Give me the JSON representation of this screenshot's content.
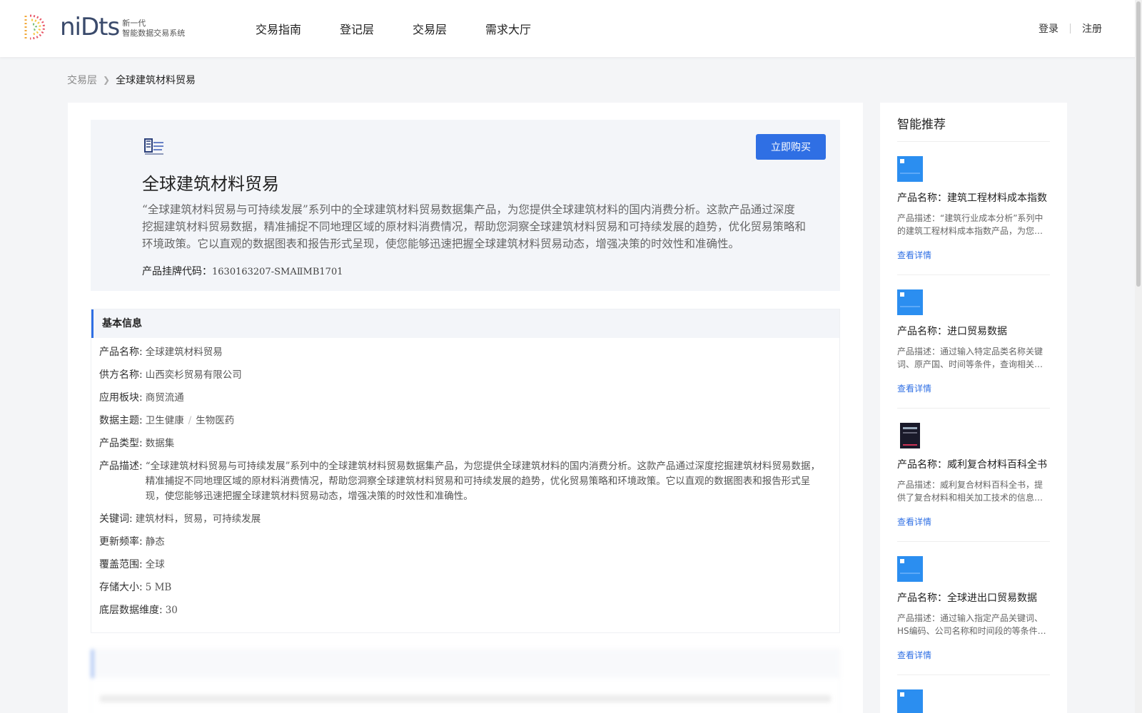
{
  "header": {
    "logo": {
      "word": "niDts",
      "sub_line1": "新一代",
      "sub_line2": "智能数据交易系统"
    },
    "nav": [
      "交易指南",
      "登记层",
      "交易层",
      "需求大厅"
    ],
    "login": "登录",
    "register": "注册"
  },
  "breadcrumb": {
    "parent": "交易层",
    "current": "全球建筑材料贸易"
  },
  "product": {
    "buy_label": "立即购买",
    "title": "全球建筑材料贸易",
    "description": "“全球建筑材料贸易与可持续发展”系列中的全球建筑材料贸易数据集产品，为您提供全球建筑材料的国内消费分析。这款产品通过深度挖掘建筑材料贸易数据，精准捕捉不同地理区域的原材料消费情况，帮助您洞察全球建筑材料贸易和可持续发展的趋势，优化贸易策略和环境政策。它以直观的数据图表和报告形式呈现，使您能够迅速把握全球建筑材料贸易动态，增强决策的时效性和准确性。",
    "code_label": "产品挂牌代码：",
    "code_value": "1630163207-SMAⅡMB1701"
  },
  "basic_info": {
    "title": "基本信息",
    "rows": [
      {
        "k": "产品名称:",
        "v": "全球建筑材料贸易"
      },
      {
        "k": "供方名称:",
        "v": "山西奕杉贸易有限公司"
      },
      {
        "k": "应用板块:",
        "v": "商贸流通"
      },
      {
        "k": "数据主题:",
        "v1": "卫生健康",
        "sep": "/",
        "v2": "生物医药"
      },
      {
        "k": "产品类型:",
        "v": "数据集"
      },
      {
        "k": "产品描述:",
        "v": "“全球建筑材料贸易与可持续发展”系列中的全球建筑材料贸易数据集产品，为您提供全球建筑材料的国内消费分析。这款产品通过深度挖掘建筑材料贸易数据，精准捕捉不同地理区域的原材料消费情况，帮助您洞察全球建筑材料贸易和可持续发展的趋势，优化贸易策略和环境政策。它以直观的数据图表和报告形式呈现，使您能够迅速把握全球建筑材料贸易动态，增强决策的时效性和准确性。"
      },
      {
        "k": "关键词:",
        "v": "建筑材料，贸易，可持续发展"
      },
      {
        "k": "更新频率:",
        "v": "静态"
      },
      {
        "k": "覆盖范围:",
        "v": "全球"
      },
      {
        "k": "存储大小:",
        "v": "5 MB"
      },
      {
        "k": "底层数据维度:",
        "v": "30"
      }
    ]
  },
  "sidebar": {
    "title": "智能推荐",
    "link_label": "查看详情",
    "cards": [
      {
        "name": "产品名称：建筑工程材料成本指数",
        "desc": "产品描述：“建筑行业成本分析”系列中的建筑工程材料成本指数产品，为您提供",
        "thumb": "#2b8ef0"
      },
      {
        "name": "产品名称：进口贸易数据",
        "desc": "产品描述：通过输入特定品类名称关键词、原产国、时间等条件，查询相关进口贸易数据",
        "thumb": "#2b8ef0"
      },
      {
        "name": "产品名称：威利复合材料百科全书",
        "desc": "产品描述：威利复合材料百科全书，提供了复合材料和相关加工技术的信息与知识",
        "thumb": "#1a1a2a"
      },
      {
        "name": "产品名称：全球进出口贸易数据",
        "desc": "产品描述：通过输入指定产品关键词、HS编码、公司名称和时间段的等条件查询",
        "thumb": "#2b8ef0"
      },
      {
        "name": "",
        "desc": "",
        "thumb": "#2b8ef0"
      }
    ]
  },
  "colors": {
    "accent": "#2f6fe4",
    "background": "#f4f5f7"
  }
}
